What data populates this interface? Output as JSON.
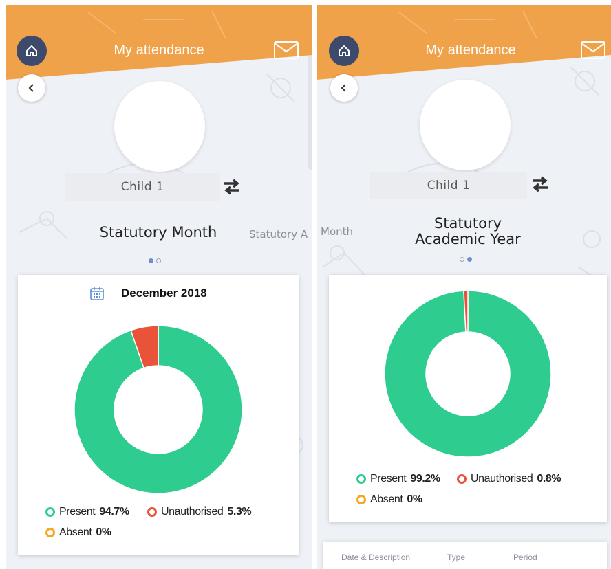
{
  "left_screen": {
    "header_title": "My attendance",
    "child_name": "Child 1",
    "tab_title": "Statutory Month",
    "next_tab_peek": "Statutory A",
    "pager": {
      "active_index": 0,
      "count": 2
    },
    "card": {
      "month_label": "December 2018",
      "legend": [
        {
          "label": "Present",
          "value": "94.7%",
          "color": "#2ecc8f"
        },
        {
          "label": "Unauthorised",
          "value": "5.3%",
          "color": "#e8533a"
        },
        {
          "label": "Absent",
          "value": "0%",
          "color": "#f5a623"
        }
      ]
    }
  },
  "right_screen": {
    "header_title": "My attendance",
    "child_name": "Child 1",
    "prev_tab_peek": "Month",
    "tab_title_line1": "Statutory",
    "tab_title_line2": "Academic Year",
    "pager": {
      "active_index": 1,
      "count": 2
    },
    "card": {
      "legend": [
        {
          "label": "Present",
          "value": "99.2%",
          "color": "#2ecc8f"
        },
        {
          "label": "Unauthorised",
          "value": "0.8%",
          "color": "#e8533a"
        },
        {
          "label": "Absent",
          "value": "0%",
          "color": "#f5a623"
        }
      ]
    },
    "table_headers": [
      "Date & Description",
      "Type",
      "Period"
    ]
  },
  "icons": {
    "home": "home-icon",
    "mail": "mail-icon",
    "back": "chevron-left-icon",
    "swap": "swap-arrows-icon",
    "calendar": "calendar-icon"
  },
  "colors": {
    "header_orange": "#f0a24a",
    "home_button": "#3d4a6b",
    "present": "#2ecc8f",
    "unauthorised": "#e8533a",
    "absent": "#f5a623"
  },
  "chart_data": [
    {
      "type": "pie",
      "title": "December 2018",
      "donut": true,
      "slices": [
        {
          "label": "Present",
          "value": 94.7
        },
        {
          "label": "Unauthorised",
          "value": 5.3
        },
        {
          "label": "Absent",
          "value": 0
        }
      ]
    },
    {
      "type": "pie",
      "title": "",
      "donut": true,
      "slices": [
        {
          "label": "Present",
          "value": 99.2
        },
        {
          "label": "Unauthorised",
          "value": 0.8
        },
        {
          "label": "Absent",
          "value": 0
        }
      ]
    }
  ]
}
